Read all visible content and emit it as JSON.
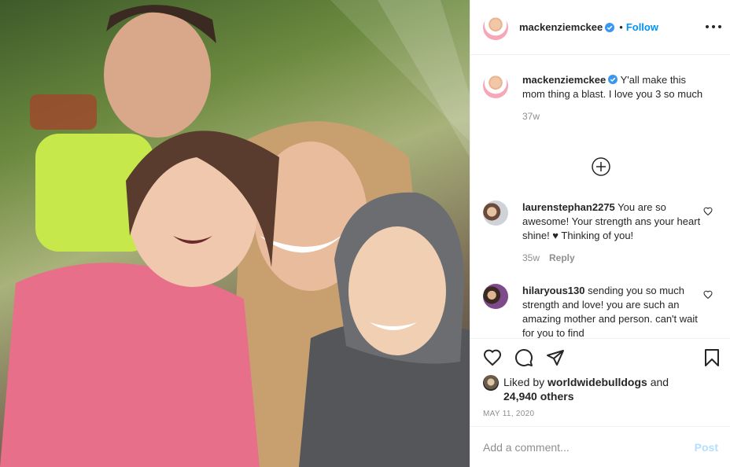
{
  "post": {
    "username": "mackenziemckee",
    "follow_label": "Follow",
    "dot": "•"
  },
  "caption": {
    "username": "mackenziemckee",
    "text": "Y'all make this mom thing a blast. I love you 3 so much",
    "time": "37w"
  },
  "comments": [
    {
      "username": "laurenstephan2275",
      "text": "You are so awesome! Your strength ans your heart shine! ♥ Thinking of you!",
      "time": "35w",
      "reply_label": "Reply"
    },
    {
      "username": "hilaryous130",
      "text": "sending you so much strength and love! you are such an amazing mother and person. can't wait for you to find",
      "time": "",
      "reply_label": ""
    }
  ],
  "likes": {
    "prefix": "Liked by",
    "user": "worldwidebulldogs",
    "and": "and",
    "others": "24,940 others"
  },
  "date": "MAY 11, 2020",
  "add_comment": {
    "placeholder": "Add a comment...",
    "post_label": "Post"
  },
  "icons": {
    "verified": "verified-badge-icon",
    "more": "more-options-icon",
    "load_more": "plus-circle-icon",
    "like": "heart-icon",
    "comment": "comment-bubble-icon",
    "share": "paper-plane-icon",
    "save": "bookmark-icon"
  },
  "colors": {
    "accent": "#0095f6",
    "verified": "#3897f0",
    "post_disabled": "#b2dffc",
    "muted": "#8e8e8e"
  }
}
